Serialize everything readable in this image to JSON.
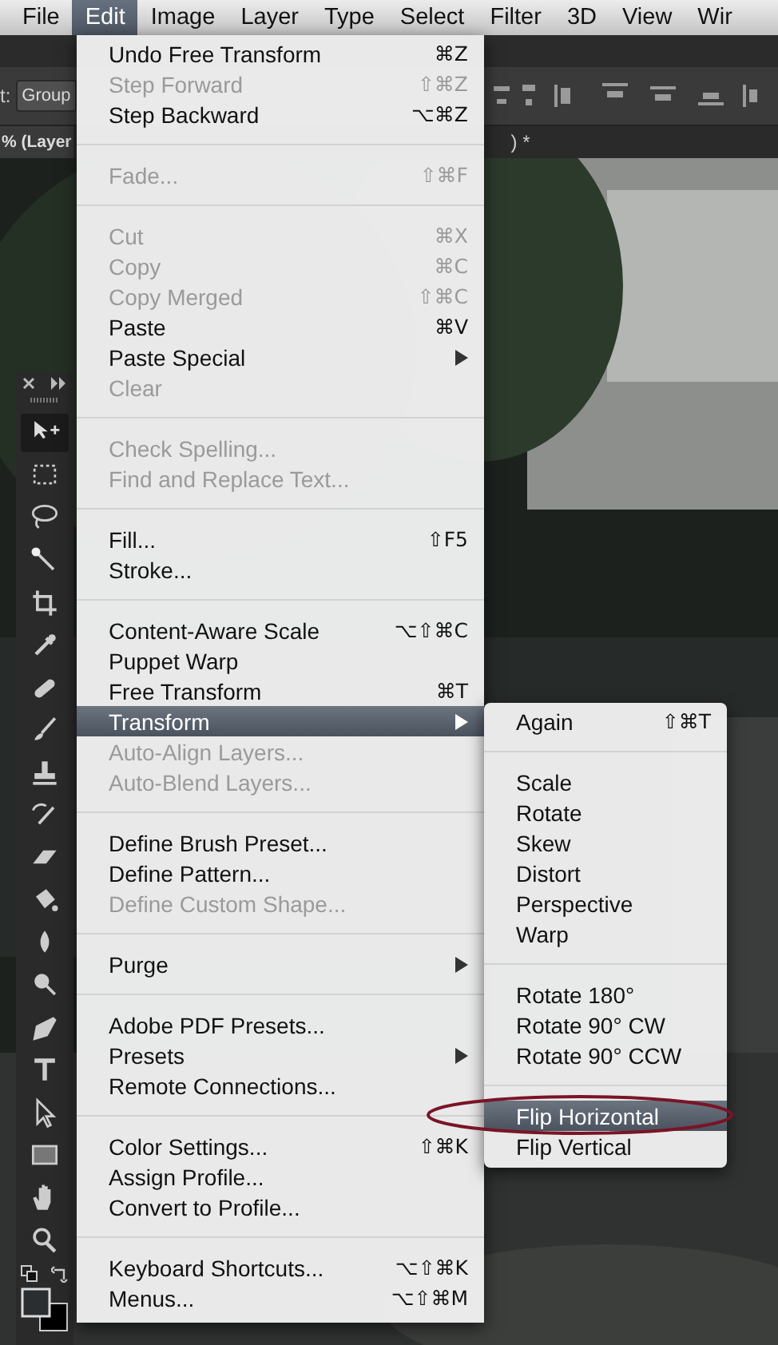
{
  "menubar": {
    "items": [
      {
        "label": "File",
        "selected": false
      },
      {
        "label": "Edit",
        "selected": true
      },
      {
        "label": "Image",
        "selected": false
      },
      {
        "label": "Layer",
        "selected": false
      },
      {
        "label": "Type",
        "selected": false
      },
      {
        "label": "Select",
        "selected": false
      },
      {
        "label": "Filter",
        "selected": false
      },
      {
        "label": "3D",
        "selected": false
      },
      {
        "label": "View",
        "selected": false
      },
      {
        "label": "Wir",
        "selected": false
      }
    ]
  },
  "options_bar": {
    "cut_label": "t:",
    "dropdown": "Group"
  },
  "document_tab": {
    "title_start": "% (Layer",
    "title_end": ") *"
  },
  "toolbar": {
    "tools": [
      {
        "kind": "move",
        "selected": true
      },
      {
        "kind": "marquee",
        "selected": false
      },
      {
        "kind": "lasso",
        "selected": false
      },
      {
        "kind": "wand",
        "selected": false
      },
      {
        "kind": "crop",
        "selected": false
      },
      {
        "kind": "eyedropper",
        "selected": false
      },
      {
        "kind": "healing",
        "selected": false
      },
      {
        "kind": "brush",
        "selected": false
      },
      {
        "kind": "stamp",
        "selected": false
      },
      {
        "kind": "history",
        "selected": false
      },
      {
        "kind": "eraser",
        "selected": false
      },
      {
        "kind": "bucket",
        "selected": false
      },
      {
        "kind": "blur",
        "selected": false
      },
      {
        "kind": "dodge",
        "selected": false
      },
      {
        "kind": "pen",
        "selected": false
      },
      {
        "kind": "type",
        "selected": false
      },
      {
        "kind": "path",
        "selected": false
      },
      {
        "kind": "rectangle",
        "selected": false
      },
      {
        "kind": "hand",
        "selected": false
      },
      {
        "kind": "zoom",
        "selected": false
      }
    ]
  },
  "edit_menu": {
    "sections": [
      {
        "items": [
          {
            "label": "Undo Free Transform",
            "shortcut": "⌘Z",
            "disabled": false,
            "submenu": false,
            "selected": false
          },
          {
            "label": "Step Forward",
            "shortcut": "⇧⌘Z",
            "disabled": true,
            "submenu": false,
            "selected": false
          },
          {
            "label": "Step Backward",
            "shortcut": "⌥⌘Z",
            "disabled": false,
            "submenu": false,
            "selected": false
          }
        ]
      },
      {
        "items": [
          {
            "label": "Fade...",
            "shortcut": "⇧⌘F",
            "disabled": true,
            "submenu": false,
            "selected": false
          }
        ]
      },
      {
        "items": [
          {
            "label": "Cut",
            "shortcut": "⌘X",
            "disabled": true,
            "submenu": false,
            "selected": false
          },
          {
            "label": "Copy",
            "shortcut": "⌘C",
            "disabled": true,
            "submenu": false,
            "selected": false
          },
          {
            "label": "Copy Merged",
            "shortcut": "⇧⌘C",
            "disabled": true,
            "submenu": false,
            "selected": false
          },
          {
            "label": "Paste",
            "shortcut": "⌘V",
            "disabled": false,
            "submenu": false,
            "selected": false
          },
          {
            "label": "Paste Special",
            "disabled": false,
            "submenu": true,
            "selected": false
          },
          {
            "label": "Clear",
            "disabled": true,
            "submenu": false,
            "selected": false
          }
        ]
      },
      {
        "items": [
          {
            "label": "Check Spelling...",
            "disabled": true,
            "submenu": false,
            "selected": false
          },
          {
            "label": "Find and Replace Text...",
            "disabled": true,
            "submenu": false,
            "selected": false
          }
        ]
      },
      {
        "items": [
          {
            "label": "Fill...",
            "shortcut": "⇧F5",
            "disabled": false,
            "submenu": false,
            "selected": false
          },
          {
            "label": "Stroke...",
            "disabled": false,
            "submenu": false,
            "selected": false
          }
        ]
      },
      {
        "items": [
          {
            "label": "Content-Aware Scale",
            "shortcut": "⌥⇧⌘C",
            "disabled": false,
            "submenu": false,
            "selected": false
          },
          {
            "label": "Puppet Warp",
            "disabled": false,
            "submenu": false,
            "selected": false
          },
          {
            "label": "Free Transform",
            "shortcut": "⌘T",
            "disabled": false,
            "submenu": false,
            "selected": false
          },
          {
            "label": "Transform",
            "disabled": false,
            "submenu": true,
            "selected": true
          },
          {
            "label": "Auto-Align Layers...",
            "disabled": true,
            "submenu": false,
            "selected": false
          },
          {
            "label": "Auto-Blend Layers...",
            "disabled": true,
            "submenu": false,
            "selected": false
          }
        ]
      },
      {
        "items": [
          {
            "label": "Define Brush Preset...",
            "disabled": false,
            "submenu": false,
            "selected": false
          },
          {
            "label": "Define Pattern...",
            "disabled": false,
            "submenu": false,
            "selected": false
          },
          {
            "label": "Define Custom Shape...",
            "disabled": true,
            "submenu": false,
            "selected": false
          }
        ]
      },
      {
        "items": [
          {
            "label": "Purge",
            "disabled": false,
            "submenu": true,
            "selected": false
          }
        ]
      },
      {
        "items": [
          {
            "label": "Adobe PDF Presets...",
            "disabled": false,
            "submenu": false,
            "selected": false
          },
          {
            "label": "Presets",
            "disabled": false,
            "submenu": true,
            "selected": false
          },
          {
            "label": "Remote Connections...",
            "disabled": false,
            "submenu": false,
            "selected": false
          }
        ]
      },
      {
        "items": [
          {
            "label": "Color Settings...",
            "shortcut": "⇧⌘K",
            "disabled": false,
            "submenu": false,
            "selected": false
          },
          {
            "label": "Assign Profile...",
            "disabled": false,
            "submenu": false,
            "selected": false
          },
          {
            "label": "Convert to Profile...",
            "disabled": false,
            "submenu": false,
            "selected": false
          }
        ]
      },
      {
        "items": [
          {
            "label": "Keyboard Shortcuts...",
            "shortcut": "⌥⇧⌘K",
            "disabled": false,
            "submenu": false,
            "selected": false
          },
          {
            "label": "Menus...",
            "shortcut": "⌥⇧⌘M",
            "disabled": false,
            "submenu": false,
            "selected": false
          }
        ]
      }
    ]
  },
  "transform_menu": {
    "sections": [
      {
        "items": [
          {
            "label": "Again",
            "shortcut": "⇧⌘T",
            "selected": false
          }
        ]
      },
      {
        "items": [
          {
            "label": "Scale",
            "selected": false
          },
          {
            "label": "Rotate",
            "selected": false
          },
          {
            "label": "Skew",
            "selected": false
          },
          {
            "label": "Distort",
            "selected": false
          },
          {
            "label": "Perspective",
            "selected": false
          },
          {
            "label": "Warp",
            "selected": false
          }
        ]
      },
      {
        "items": [
          {
            "label": "Rotate 180°",
            "selected": false
          },
          {
            "label": "Rotate 90° CW",
            "selected": false
          },
          {
            "label": "Rotate 90° CCW",
            "selected": false
          }
        ]
      },
      {
        "items": [
          {
            "label": "Flip Horizontal",
            "selected": true
          },
          {
            "label": "Flip Vertical",
            "selected": false
          }
        ]
      }
    ]
  }
}
